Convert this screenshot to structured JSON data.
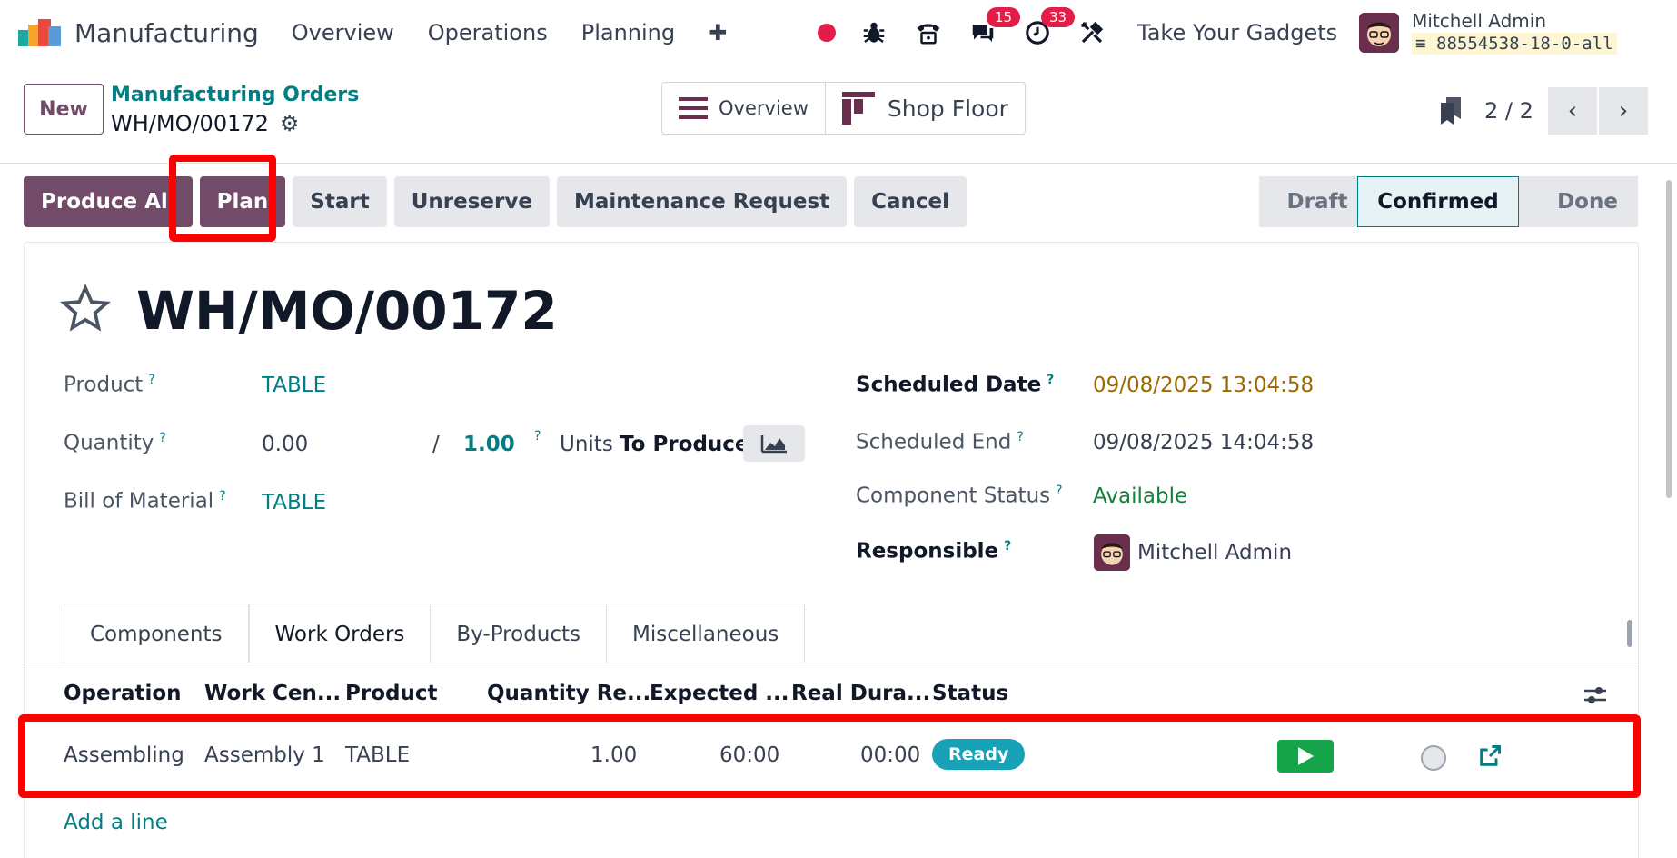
{
  "app": {
    "name": "Manufacturing"
  },
  "nav": {
    "menu": [
      "Overview",
      "Operations",
      "Planning"
    ],
    "plus": "✚",
    "messages_count": "15",
    "activities_count": "33",
    "company": "Take Your Gadgets",
    "user_name": "Mitchell Admin",
    "database": "88554538-18-0-all"
  },
  "control": {
    "new_label": "New",
    "breadcrumb_parent": "Manufacturing Orders",
    "breadcrumb_current": "WH/MO/00172",
    "views": [
      "Overview",
      "Shop Floor"
    ],
    "pager": "2 / 2"
  },
  "actions": {
    "produce_all": "Produce All",
    "plan": "Plan",
    "start": "Start",
    "unreserve": "Unreserve",
    "maintenance": "Maintenance Request",
    "cancel": "Cancel"
  },
  "status": {
    "steps": [
      "Draft",
      "Confirmed",
      "Done"
    ],
    "current": "Confirmed"
  },
  "form": {
    "title": "WH/MO/00172",
    "product_label": "Product",
    "product": "TABLE",
    "quantity_label": "Quantity",
    "quantity_produced": "0.00",
    "quantity_sep": "/",
    "quantity_total": "1.00",
    "units": "Units",
    "to_produce": "To Produce",
    "bom_label": "Bill of Material",
    "bom": "TABLE",
    "scheduled_date_label": "Scheduled Date",
    "scheduled_date": "09/08/2025 13:04:58",
    "scheduled_end_label": "Scheduled End",
    "scheduled_end": "09/08/2025 14:04:58",
    "component_status_label": "Component Status",
    "component_status": "Available",
    "responsible_label": "Responsible",
    "responsible": "Mitchell Admin",
    "help": "?"
  },
  "tabs": [
    "Components",
    "Work Orders",
    "By-Products",
    "Miscellaneous"
  ],
  "active_tab": "Work Orders",
  "work_orders": {
    "columns": [
      "Operation",
      "Work Cen...",
      "Product",
      "Quantity Re...",
      "Expected ...",
      "Real Dura...",
      "Status"
    ],
    "rows": [
      {
        "operation": "Assembling",
        "work_center": "Assembly 1",
        "product": "TABLE",
        "quantity": "1.00",
        "expected": "60:00",
        "real": "00:00",
        "status": "Ready"
      }
    ],
    "add_line": "Add a line"
  },
  "colors": {
    "primary": "#714b67",
    "link": "#017e84",
    "highlight": "#ff0000",
    "ready": "#17a2b8"
  }
}
